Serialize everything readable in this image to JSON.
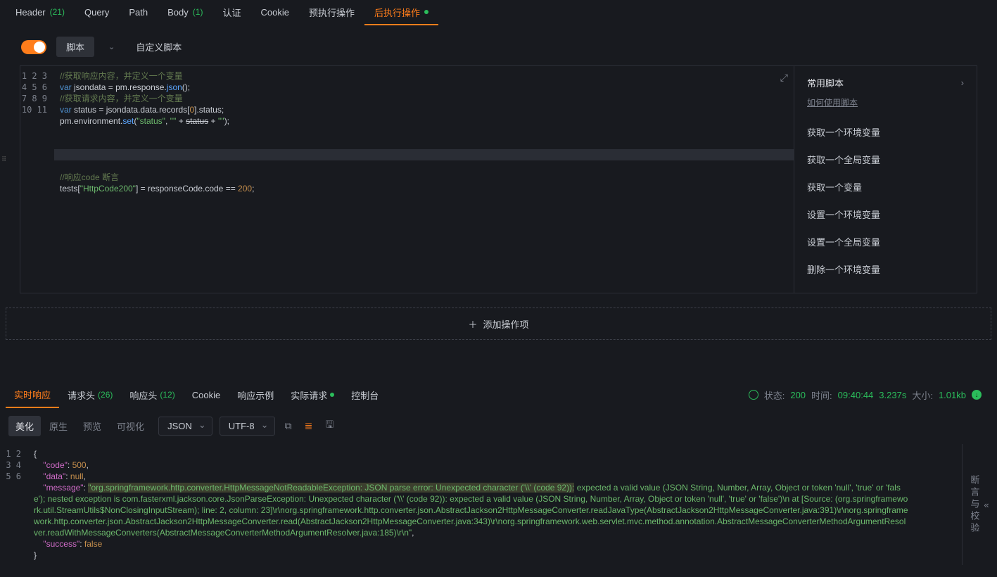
{
  "topTabs": [
    {
      "label": "Header",
      "count": "(21)"
    },
    {
      "label": "Query"
    },
    {
      "label": "Path"
    },
    {
      "label": "Body",
      "count": "(1)"
    },
    {
      "label": "认证"
    },
    {
      "label": "Cookie"
    },
    {
      "label": "预执行操作"
    },
    {
      "label": "后执行操作",
      "active": true,
      "dot": true
    }
  ],
  "scriptBar": {
    "pill": "脚本",
    "title": "自定义脚本"
  },
  "code": {
    "lines": [
      {
        "n": 1,
        "html": "<span class='t-c'>//获取响应内容，并定义一个变量</span>"
      },
      {
        "n": 2,
        "html": "<span class='t-kw'>var</span> <span class='t-v'>jsondata</span> = pm.response.<span class='t-f'>json</span>();"
      },
      {
        "n": 3,
        "html": "<span class='t-c'>//获取请求内容，并定义一个变量</span>"
      },
      {
        "n": 4,
        "html": "<span class='t-kw'>var</span> <span class='t-v'>status</span> = jsondata.data.records[<span class='t-n'>0</span>].status;"
      },
      {
        "n": 5,
        "html": "pm.environment.<span class='t-f'>set</span>(<span class='t-s'>\"status\"</span>, <span class='t-s'>'\"'</span> + <s>status</s> + <span class='t-s'>'\"'</span>);"
      },
      {
        "n": 6,
        "html": ""
      },
      {
        "n": 7,
        "html": ""
      },
      {
        "n": 8,
        "html": "",
        "hl": true
      },
      {
        "n": 9,
        "html": ""
      },
      {
        "n": 10,
        "html": "<span class='t-c'>//响应code 断言</span>"
      },
      {
        "n": 11,
        "html": "tests[<span class='t-s'>\"HttpCode200\"</span>] = responseCode.code == <span class='t-n'>200</span>;"
      }
    ]
  },
  "snippets": {
    "title": "常用脚本",
    "help": "如何使用脚本",
    "items": [
      "获取一个环境变量",
      "获取一个全局变量",
      "获取一个变量",
      "设置一个环境变量",
      "设置一个全局变量",
      "删除一个环境变量"
    ]
  },
  "addAction": "添加操作项",
  "respTabs": [
    {
      "label": "实时响应",
      "active": true
    },
    {
      "label": "请求头",
      "count": "(26)"
    },
    {
      "label": "响应头",
      "count": "(12)"
    },
    {
      "label": "Cookie"
    },
    {
      "label": "响应示例"
    },
    {
      "label": "实际请求",
      "dot": true
    },
    {
      "label": "控制台"
    }
  ],
  "status": {
    "label1": "状态:",
    "code": "200",
    "label2": "时间:",
    "time": "09:40:44",
    "dur": "3.237s",
    "label3": "大小:",
    "size": "1.01kb"
  },
  "viewSeg": [
    "美化",
    "原生",
    "预览",
    "可视化"
  ],
  "format": "JSON",
  "encoding": "UTF-8",
  "respCode": {
    "lines": [
      {
        "n": 1,
        "html": "{"
      },
      {
        "n": 2,
        "html": "&nbsp;&nbsp;&nbsp;&nbsp;<span class='jk'>\"code\"</span>: <span class='jn'>500</span>,"
      },
      {
        "n": 3,
        "html": "&nbsp;&nbsp;&nbsp;&nbsp;<span class='jk'>\"data\"</span>: <span class='jb'>null</span>,"
      },
      {
        "n": 4,
        "html": "&nbsp;&nbsp;&nbsp;&nbsp;<span class='jk'>\"message\"</span>: <span class='jv'><span class='msg-hl'>\"org.springframework.http.converter.HttpMessageNotReadableException: JSON parse error: Unexpected character ('\\\\' (code 92)):</span> expected a valid value (JSON String, Number, Array, Object or token 'null', 'true' or 'false'); nested exception is com.fasterxml.jackson.core.JsonParseException: Unexpected character ('\\\\' (code 92)): expected a valid value (JSON String, Number, Array, Object or token 'null', 'true' or 'false')\\n at [Source: (org.springframework.util.StreamUtils$NonClosingInputStream); line: 2, column: 23]\\r\\norg.springframework.http.converter.json.AbstractJackson2HttpMessageConverter.readJavaType(AbstractJackson2HttpMessageConverter.java:391)\\r\\norg.springframework.http.converter.json.AbstractJackson2HttpMessageConverter.read(AbstractJackson2HttpMessageConverter.java:343)\\r\\norg.springframework.web.servlet.mvc.method.annotation.AbstractMessageConverterMethodArgumentResolver.readWithMessageConverters(AbstractMessageConverterMethodArgumentResolver.java:185)\\r\\n\"</span>,"
      },
      {
        "n": 5,
        "html": "&nbsp;&nbsp;&nbsp;&nbsp;<span class='jk'>\"success\"</span>: <span class='jb'>false</span>"
      },
      {
        "n": 6,
        "html": "}"
      }
    ]
  },
  "vpanel": "断言与校验"
}
